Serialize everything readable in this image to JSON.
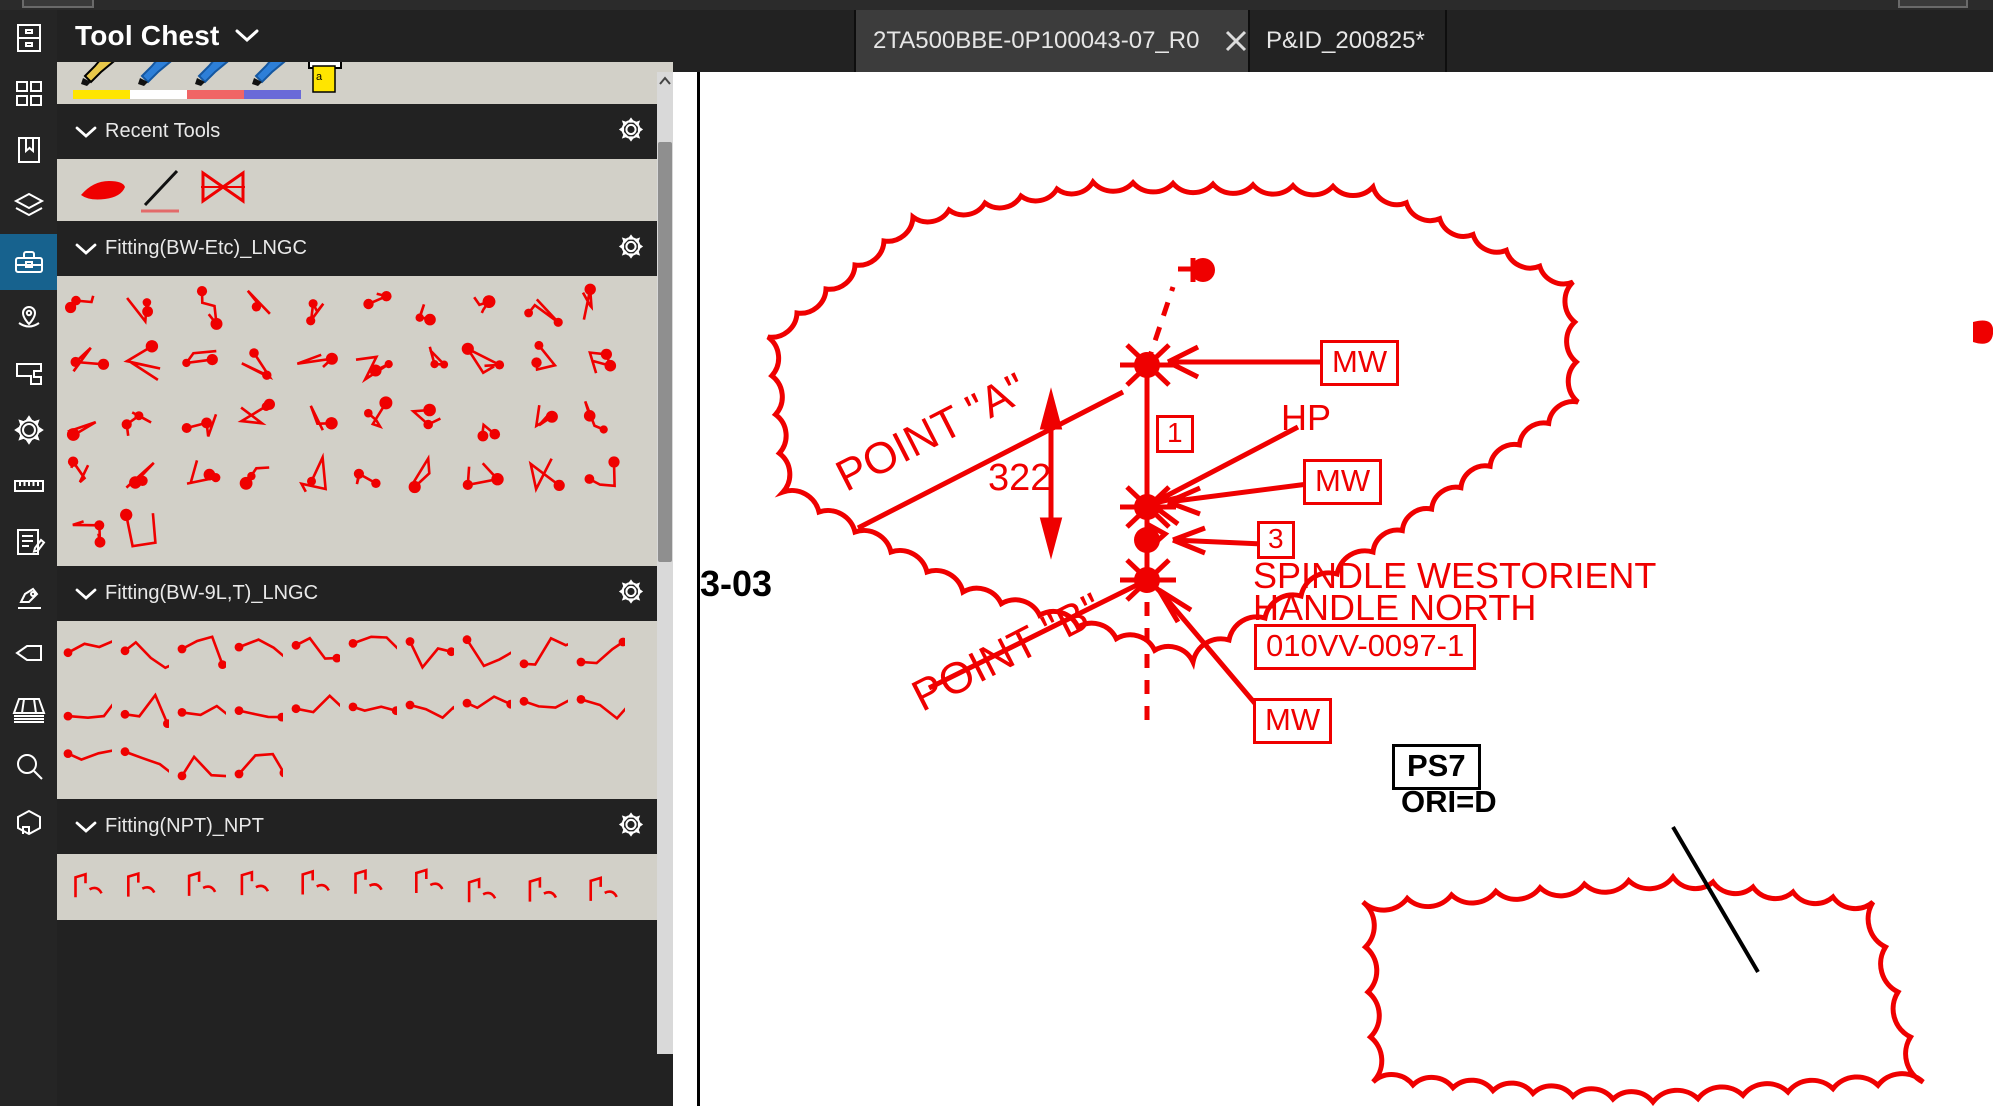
{
  "app": {
    "accent_color": "#17628e",
    "panel_bg": "#222222",
    "tool_bg": "#d2d0c8",
    "markup_red": "#ef0000"
  },
  "rail": {
    "items": [
      {
        "icon": "file-cabinet-icon",
        "name": "sidebar-item-file-cabinet",
        "active": false
      },
      {
        "icon": "grid-thumbnails-icon",
        "name": "sidebar-item-thumbnails",
        "active": false
      },
      {
        "icon": "bookmark-icon",
        "name": "sidebar-item-bookmarks",
        "active": false
      },
      {
        "icon": "layers-icon",
        "name": "sidebar-item-layers",
        "active": false
      },
      {
        "icon": "toolbox-icon",
        "name": "sidebar-item-tool-chest",
        "active": true
      },
      {
        "icon": "location-pin-icon",
        "name": "sidebar-item-location",
        "active": false
      },
      {
        "icon": "floorplan-icon",
        "name": "sidebar-item-spaces",
        "active": false
      },
      {
        "icon": "gear-icon",
        "name": "sidebar-item-settings",
        "active": false
      },
      {
        "icon": "ruler-icon",
        "name": "sidebar-item-measure",
        "active": false
      },
      {
        "icon": "form-edit-icon",
        "name": "sidebar-item-forms",
        "active": false
      },
      {
        "icon": "pen-signature-icon",
        "name": "sidebar-item-signature",
        "active": false
      },
      {
        "icon": "tag-icon",
        "name": "sidebar-item-tags",
        "active": false
      },
      {
        "icon": "sheet-stack-icon",
        "name": "sidebar-item-sheets",
        "active": false
      },
      {
        "icon": "search-icon",
        "name": "sidebar-item-search",
        "active": false
      },
      {
        "icon": "model-3d-icon",
        "name": "sidebar-item-3d-model",
        "active": false
      }
    ]
  },
  "panel": {
    "title": "Tool Chest",
    "title_caret_icon": "chevron-down-icon",
    "highlighters": {
      "swatches": [
        "#ffe500",
        "#ffffff",
        "#f06565",
        "#6a6ad8"
      ],
      "note_color": "#ffe500",
      "note_letter": "a"
    },
    "sections": [
      {
        "label": "Recent Tools",
        "caret_icon": "chevron-down-icon",
        "gear_icon": "gear-icon",
        "kind": "recent",
        "recent_tools": [
          "highlight-swipe-tool",
          "leader-line-tool",
          "butterfly-valve-tool"
        ]
      },
      {
        "label": "Fitting(BW-Etc)_LNGC",
        "caret_icon": "chevron-down-icon",
        "gear_icon": "gear-icon",
        "kind": "grid",
        "rows": 5,
        "cols": 10,
        "last_row_count": 2
      },
      {
        "label": "Fitting(BW-9L,T)_LNGC",
        "caret_icon": "chevron-down-icon",
        "gear_icon": "gear-icon",
        "kind": "grid",
        "rows": 3,
        "cols": 10,
        "last_row_count": 4
      },
      {
        "label": "Fitting(NPT)_NPT",
        "caret_icon": "chevron-down-icon",
        "gear_icon": "gear-icon",
        "kind": "grid",
        "rows": 1,
        "cols": 10,
        "last_row_count": 10
      }
    ],
    "scrollbar": {
      "up_arrow_icon": "chevron-up-icon",
      "down_arrow_icon": "chevron-down-icon"
    }
  },
  "tabs": {
    "items": [
      {
        "label": "2TA500BBE-0P100043-07_R0",
        "active": true,
        "close_icon": "close-icon"
      },
      {
        "label": "P&ID_200825*",
        "active": false,
        "close_icon": ""
      }
    ]
  },
  "canvas": {
    "sheet_partial_number": "3-03",
    "annotations": [
      {
        "name": "point-a-label",
        "text": "POINT \"A\"",
        "kind": "rotated"
      },
      {
        "name": "point-b-label",
        "text": "POINT \"B\"",
        "kind": "rotated"
      },
      {
        "name": "dimension-322",
        "text": "322",
        "kind": "dimension"
      },
      {
        "name": "callout-bubble-1",
        "text": "1",
        "kind": "boxed-red"
      },
      {
        "name": "callout-bubble-3",
        "text": "3",
        "kind": "boxed-red"
      },
      {
        "name": "tag-mw-top",
        "text": "MW",
        "kind": "boxed-red"
      },
      {
        "name": "tag-mw-middle",
        "text": "MW",
        "kind": "boxed-red"
      },
      {
        "name": "tag-mw-bottom",
        "text": "MW",
        "kind": "boxed-red"
      },
      {
        "name": "tag-hp",
        "text": "HP",
        "kind": "plain-red"
      },
      {
        "name": "note-spindle-line-1",
        "text": "SPINDLE WESTORIENT",
        "kind": "plain-red"
      },
      {
        "name": "note-spindle-line-2",
        "text": "HANDLE NORTH",
        "kind": "plain-red"
      },
      {
        "name": "valve-tag-number",
        "text": "010VV-0097-1",
        "kind": "boxed-red"
      },
      {
        "name": "pipe-spec-ps7",
        "text": "PS7",
        "kind": "boxed-black"
      },
      {
        "name": "orientation-ori-d",
        "text": "ORI=D",
        "kind": "plain-black"
      }
    ]
  }
}
